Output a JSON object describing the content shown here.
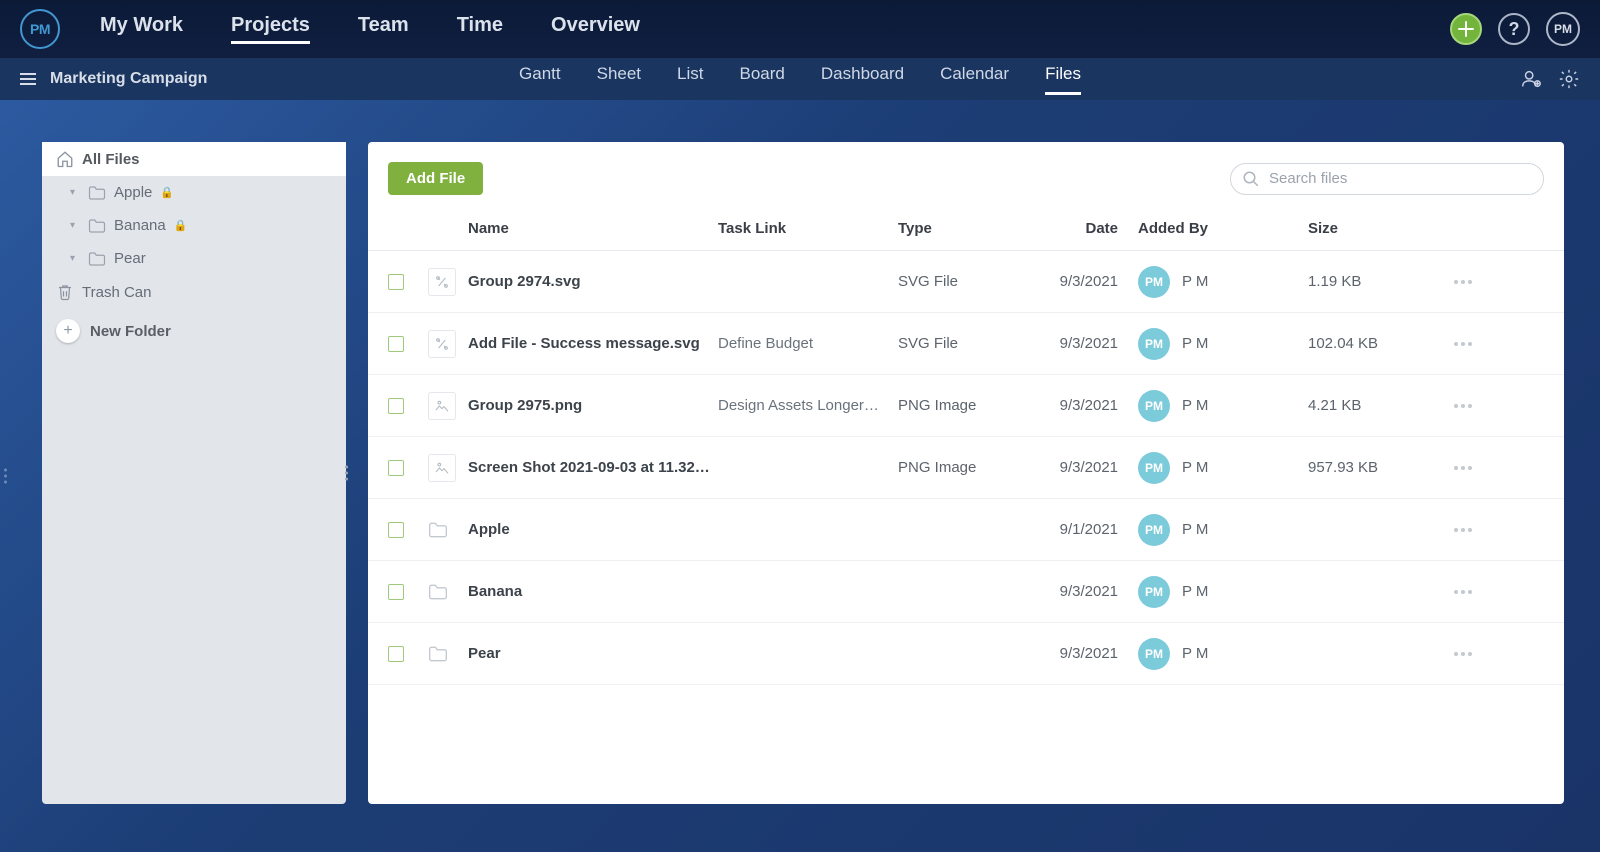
{
  "app": {
    "logo": "PM"
  },
  "nav": {
    "items": [
      {
        "label": "My Work",
        "active": false
      },
      {
        "label": "Projects",
        "active": true
      },
      {
        "label": "Team",
        "active": false
      },
      {
        "label": "Time",
        "active": false
      },
      {
        "label": "Overview",
        "active": false
      }
    ],
    "avatar": "PM"
  },
  "subbar": {
    "project_name": "Marketing Campaign",
    "tabs": [
      {
        "label": "Gantt",
        "active": false
      },
      {
        "label": "Sheet",
        "active": false
      },
      {
        "label": "List",
        "active": false
      },
      {
        "label": "Board",
        "active": false
      },
      {
        "label": "Dashboard",
        "active": false
      },
      {
        "label": "Calendar",
        "active": false
      },
      {
        "label": "Files",
        "active": true
      }
    ]
  },
  "sidebar": {
    "items": [
      {
        "label": "All Files",
        "type": "home",
        "selected": true
      },
      {
        "label": "Apple",
        "type": "folder",
        "locked": true
      },
      {
        "label": "Banana",
        "type": "folder",
        "locked": true
      },
      {
        "label": "Pear",
        "type": "folder",
        "locked": false
      },
      {
        "label": "Trash Can",
        "type": "trash"
      }
    ],
    "new_folder": "New Folder"
  },
  "panel": {
    "add_file": "Add File",
    "search_placeholder": "Search files",
    "columns": {
      "name": "Name",
      "task": "Task Link",
      "type": "Type",
      "date": "Date",
      "added_by": "Added By",
      "size": "Size"
    }
  },
  "files": [
    {
      "name": "Group 2974.svg",
      "task": "",
      "type": "SVG File",
      "date": "9/3/2021",
      "added_by": "P M",
      "avatar": "PM",
      "size": "1.19 KB",
      "icon": "vector"
    },
    {
      "name": "Add File - Success message.svg",
      "task": "Define Budget",
      "type": "SVG File",
      "date": "9/3/2021",
      "added_by": "P M",
      "avatar": "PM",
      "size": "102.04 KB",
      "icon": "vector"
    },
    {
      "name": "Group 2975.png",
      "task": "Design Assets Longer…",
      "type": "PNG Image",
      "date": "9/3/2021",
      "added_by": "P M",
      "avatar": "PM",
      "size": "4.21 KB",
      "icon": "image"
    },
    {
      "name": "Screen Shot 2021-09-03 at 11.32…",
      "task": "",
      "type": "PNG Image",
      "date": "9/3/2021",
      "added_by": "P M",
      "avatar": "PM",
      "size": "957.93 KB",
      "icon": "image"
    },
    {
      "name": "Apple",
      "task": "",
      "type": "",
      "date": "9/1/2021",
      "added_by": "P M",
      "avatar": "PM",
      "size": "",
      "icon": "folder"
    },
    {
      "name": "Banana",
      "task": "",
      "type": "",
      "date": "9/3/2021",
      "added_by": "P M",
      "avatar": "PM",
      "size": "",
      "icon": "folder"
    },
    {
      "name": "Pear",
      "task": "",
      "type": "",
      "date": "9/3/2021",
      "added_by": "P M",
      "avatar": "PM",
      "size": "",
      "icon": "folder"
    }
  ]
}
